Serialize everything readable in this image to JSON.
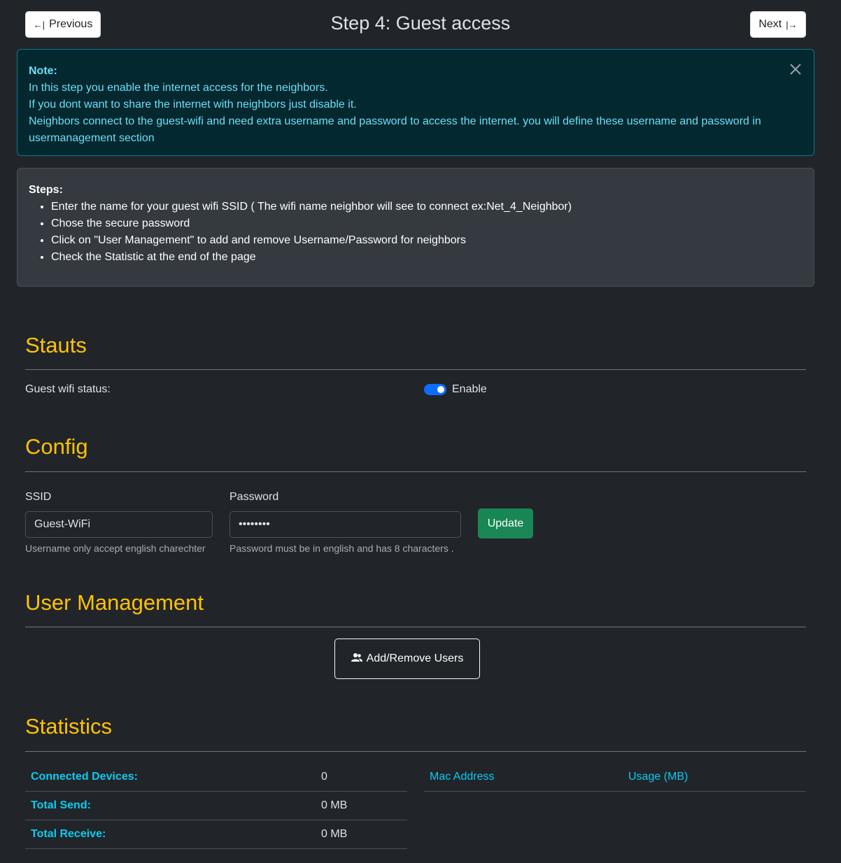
{
  "header": {
    "title": "Step 4: Guest access",
    "prev_label": "Previous",
    "next_label": "Next",
    "prev_icon": "←|",
    "next_icon": "|→"
  },
  "note": {
    "title": "Note:",
    "lines": [
      "In this step you enable the internet access for the neighbors.",
      "If you dont want to share the internet with neighbors just disable it.",
      "Neighbors connect to the guest-wifi and need extra username and password to access the internet. you will define these username and password in usermanagement section"
    ]
  },
  "steps": {
    "title": "Steps:",
    "items": [
      "Enter the name for your guest wifi SSID ( The wifi name neighbor will see to connect ex:Net_4_Neighbor)",
      "Chose the secure password",
      "Click on \"User Management\" to add and remove Username/Password for neighbors",
      "Check the Statistic at the end of the page"
    ]
  },
  "status": {
    "title": "Stauts",
    "guest_label": "Guest wifi status:",
    "toggle_label": "Enable",
    "enabled": true
  },
  "config": {
    "title": "Config",
    "ssid_label": "SSID",
    "ssid_value": "Guest-WiFi",
    "ssid_help": "Username only accept english charechter",
    "password_label": "Password",
    "password_value": "12345678",
    "password_help": "Password must be in english and has 8 characters .",
    "update_label": "Update"
  },
  "users": {
    "title": "User Management",
    "button_label": "Add/Remove Users"
  },
  "statistics": {
    "title": "Statistics",
    "rows": [
      {
        "label": "Connected Devices:",
        "value": "0"
      },
      {
        "label": "Total Send:",
        "value": "0 MB"
      },
      {
        "label": "Total Receive:",
        "value": "0 MB"
      }
    ],
    "mac_header": "Mac Address",
    "usage_header": "Usage (MB)"
  },
  "colors": {
    "background": "#212529",
    "accent": "#ffc107",
    "info": "#0dcaf0",
    "success": "#198754",
    "primary": "#0d6efd"
  }
}
